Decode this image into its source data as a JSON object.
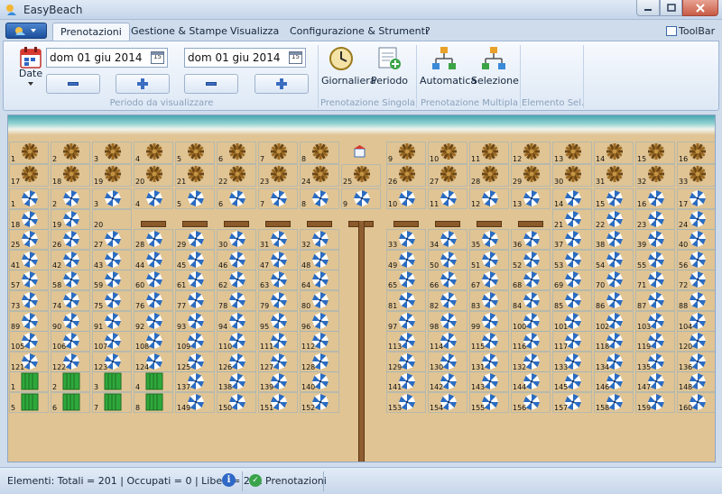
{
  "window": {
    "title": "EasyBeach"
  },
  "ribbon": {
    "tabs": [
      "Prenotazioni",
      "Gestione & Stampe",
      "Visualizza",
      "Configurazione & Strumenti",
      "?"
    ],
    "active_tab": 0,
    "toolbar_toggle": "ToolBar",
    "period": {
      "date_button": "Date",
      "start_date": "dom 01 giu 2014",
      "end_date": "dom 01 giu 2014",
      "calendar_day": "15",
      "group_label": "Periodo da visualizzare"
    },
    "single": {
      "daily": "Giornaliera",
      "period": "Periodo",
      "group_label": "Prenotazione Singola"
    },
    "multiple": {
      "automatic": "Automatica",
      "selection": "Selezione",
      "group_label": "Prenotazione Multipla"
    },
    "element": {
      "group_label": "Elemento Sel."
    }
  },
  "beach": {
    "palm_rows": [
      [
        "1",
        "2",
        "3",
        "4",
        "5",
        "6",
        "7",
        "8",
        "",
        "9",
        "10",
        "11",
        "12",
        "13",
        "14",
        "15",
        "16"
      ],
      [
        "17",
        "18",
        "19",
        "20",
        "21",
        "22",
        "23",
        "24",
        "25",
        "26",
        "27",
        "28",
        "29",
        "30",
        "31",
        "32",
        "33"
      ]
    ],
    "umbrella_rows": [
      [
        "1",
        "2",
        "3",
        "4",
        "5",
        "6",
        "7",
        "8",
        "9",
        "10",
        "11",
        "12",
        "13",
        "14",
        "15",
        "16",
        "17"
      ],
      [
        "18",
        "19",
        "20",
        "",
        "",
        "",
        "",
        "",
        "",
        "",
        "",
        "",
        "",
        "21",
        "22",
        "23",
        "24"
      ],
      [
        "25",
        "26",
        "27",
        "28",
        "29",
        "30",
        "31",
        "32",
        "",
        "33",
        "34",
        "35",
        "36",
        "37",
        "38",
        "39",
        "40"
      ],
      [
        "41",
        "42",
        "43",
        "44",
        "45",
        "46",
        "47",
        "48",
        "",
        "49",
        "50",
        "51",
        "52",
        "53",
        "54",
        "55",
        "56"
      ],
      [
        "57",
        "58",
        "59",
        "60",
        "61",
        "62",
        "63",
        "64",
        "",
        "65",
        "66",
        "67",
        "68",
        "69",
        "70",
        "71",
        "72"
      ],
      [
        "73",
        "74",
        "75",
        "76",
        "77",
        "78",
        "79",
        "80",
        "",
        "81",
        "82",
        "83",
        "84",
        "85",
        "86",
        "87",
        "88"
      ],
      [
        "89",
        "90",
        "91",
        "92",
        "93",
        "94",
        "95",
        "96",
        "",
        "97",
        "98",
        "99",
        "100",
        "101",
        "102",
        "103",
        "104"
      ],
      [
        "105",
        "106",
        "107",
        "108",
        "109",
        "110",
        "111",
        "112",
        "",
        "113",
        "114",
        "115",
        "116",
        "117",
        "118",
        "119",
        "120"
      ],
      [
        "121",
        "122",
        "123",
        "124",
        "125",
        "126",
        "127",
        "128",
        "",
        "129",
        "130",
        "131",
        "132",
        "133",
        "134",
        "135",
        "136"
      ],
      [
        "1",
        "2",
        "3",
        "4",
        "137",
        "138",
        "139",
        "140",
        "",
        "141",
        "142",
        "143",
        "144",
        "145",
        "146",
        "147",
        "148"
      ],
      [
        "5",
        "6",
        "7",
        "8",
        "149",
        "150",
        "151",
        "152",
        "",
        "153",
        "154",
        "155",
        "156",
        "157",
        "158",
        "159",
        "160"
      ]
    ]
  },
  "statusbar": {
    "summary": "Elementi: Totali = 201 | Occupati = 0 | Liberi = 201",
    "info_glyph": "i",
    "ok_glyph": "✓",
    "mode": "Prenotazioni"
  },
  "colors": {
    "umbrella_blue": "#2a6cc2",
    "palm_brown": "#6b4614",
    "sun_bed_green": "#2fa83b",
    "sand": "#e0c494"
  }
}
